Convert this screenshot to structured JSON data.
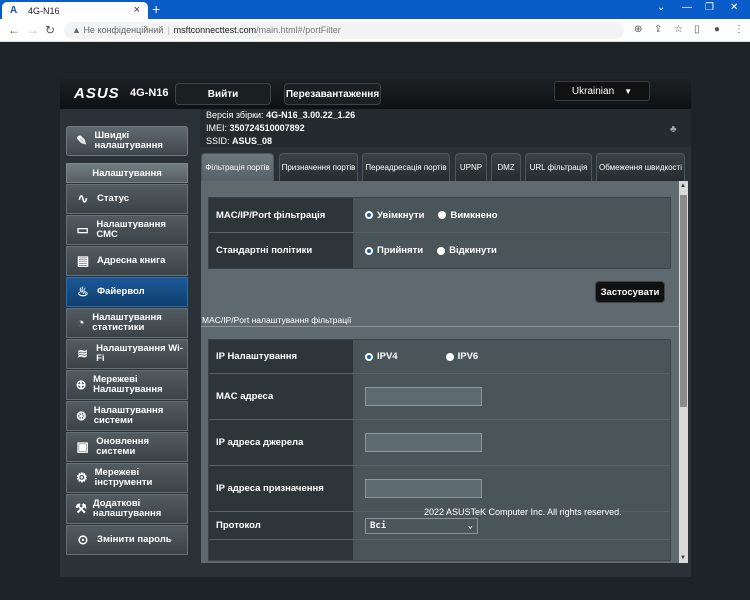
{
  "browser": {
    "tab_title": "4G-N16",
    "tab_logo": "A",
    "url_security": "Не конфіденційний",
    "url_host": "msftconnecttest.com",
    "url_path": "/main.html#/portFilter"
  },
  "router": {
    "brand": "ASUS",
    "model": "4G-N16",
    "buttons": {
      "logout": "Вийти",
      "reboot": "Перезавантаження"
    },
    "language": "Ukrainian",
    "info": {
      "firmware_label": "Версія збірки:",
      "firmware_value": "4G-N16_3.00.22_1.26",
      "imei_label": "IMEI:",
      "imei_value": "350724510007892",
      "ssid_label": "SSID:",
      "ssid_value": "ASUS_08"
    },
    "sidebar": {
      "quick_setup": "Швидкі налаштування",
      "section_header": "Налаштування",
      "items": [
        {
          "label": "Статус",
          "icon": "status-icon"
        },
        {
          "label": "Налаштування СМС",
          "icon": "sms-icon"
        },
        {
          "label": "Адресна книга",
          "icon": "address-book-icon"
        },
        {
          "label": "Файервол",
          "icon": "firewall-icon"
        },
        {
          "label": "Налаштування статистики",
          "icon": "statistics-icon"
        },
        {
          "label": "Налаштування Wi-Fi",
          "icon": "wifi-icon"
        },
        {
          "label": "Мережеві Налаштування",
          "icon": "network-icon"
        },
        {
          "label": "Налаштування системи",
          "icon": "system-icon"
        },
        {
          "label": "Оновлення системи",
          "icon": "update-icon"
        },
        {
          "label": "Мережеві інструменти",
          "icon": "tools-icon"
        },
        {
          "label": "Додаткові налаштування",
          "icon": "advanced-icon"
        },
        {
          "label": "Змінити пароль",
          "icon": "lock-icon"
        }
      ]
    },
    "tabs": [
      "Фільтрація портів",
      "Призначення портів",
      "Переадресація портів",
      "UPNP",
      "DMZ",
      "URL фільтрація",
      "Обмеження швидкості"
    ],
    "filter_settings": {
      "mac_ip_port_label": "MAC/IP/Port фільтрація",
      "on": "Увімкнути",
      "off": "Вимкнено",
      "policy_label": "Стандартні політики",
      "accept": "Прийняти",
      "reject": "Відкинути"
    },
    "apply_button": "Застосувати",
    "section_title": "MAC/IP/Port налаштування фільтрації",
    "rule_form": {
      "ip_settings_label": "IP Налаштування",
      "ipv4": "IPV4",
      "ipv6": "IPV6",
      "mac_label": "MAC адреса",
      "src_ip_label": "IP адреса джерела",
      "dst_ip_label": "IP адреса призначення",
      "protocol_label": "Протокол",
      "protocol_value": "Всі"
    },
    "footer": "2022 ASUSTeK Computer Inc. All rights reserved."
  }
}
